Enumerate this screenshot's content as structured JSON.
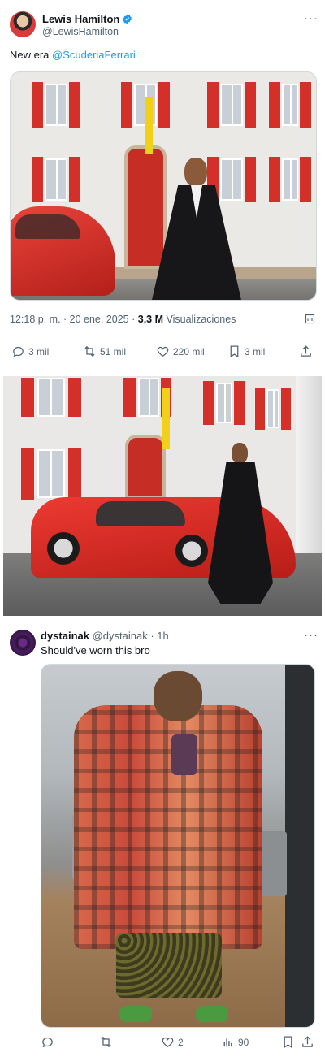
{
  "tweet": {
    "author_name": "Lewis Hamilton",
    "author_handle": "@LewisHamilton",
    "text_prefix": "New era ",
    "mention": "@ScuderiaFerrari",
    "time": "12:18 p. m. · 20 ene. 2025 · ",
    "views_count": "3,3 M",
    "views_label": " Visualizaciones",
    "actions": {
      "replies": "3 mil",
      "reposts": "51 mil",
      "likes": "220 mil",
      "bookmarks": "3 mil"
    }
  },
  "reply": {
    "author_name": "dystainak",
    "author_handle": "@dystainak",
    "time_ago": "· 1h",
    "text": "Should've worn this bro",
    "actions": {
      "replies": "",
      "reposts": "",
      "likes": "2",
      "views": "90"
    }
  },
  "colors": {
    "accent": "#1d9bf0",
    "muted": "#536471",
    "text": "#0f1419",
    "ferrari_red": "#d4302a"
  },
  "icons": [
    "verified-badge-icon",
    "more-icon",
    "reply-icon",
    "repost-icon",
    "like-icon",
    "bookmark-icon",
    "share-icon",
    "views-icon",
    "analytics-icon"
  ]
}
